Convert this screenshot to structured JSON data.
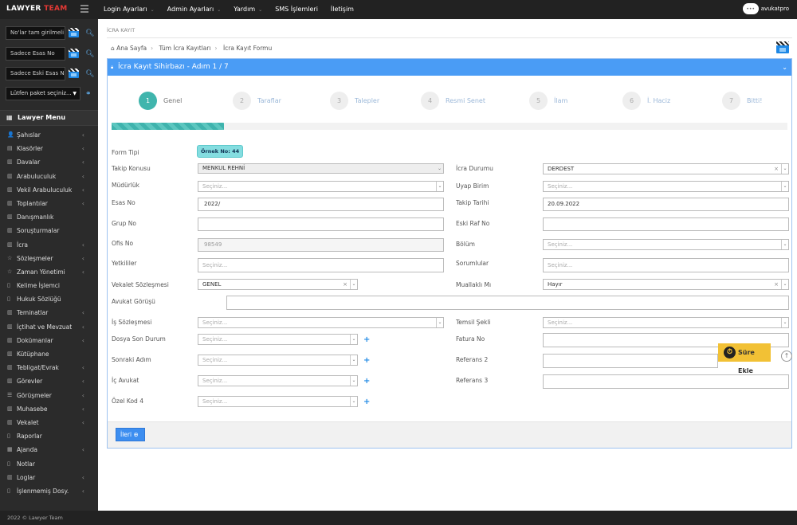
{
  "brand": {
    "name": "LAWYER",
    "accent": "TEAM",
    "accent_color": "#e53935"
  },
  "topnav": [
    {
      "label": "Login Ayarları",
      "caret": true
    },
    {
      "label": "Admin Ayarları",
      "caret": true
    },
    {
      "label": "Yardım",
      "caret": true
    },
    {
      "label": "SMS İşlemleri",
      "caret": false
    },
    {
      "label": "İletişim",
      "caret": false
    }
  ],
  "user": {
    "name": "avukatpro",
    "avatar": "•••"
  },
  "search": [
    {
      "placeholder": "No'lar tam girilmeli"
    },
    {
      "placeholder": "Sadece Esas No"
    },
    {
      "placeholder": "Sadece Eski Esas No"
    }
  ],
  "package_select": "Lütfen paket seçiniz...",
  "menu_title": "Lawyer Menu",
  "menu": [
    {
      "label": "Şahıslar",
      "icon": "user-icon",
      "glyph": "👤",
      "chevron": true
    },
    {
      "label": "Klasörler",
      "icon": "folder-icon",
      "glyph": "▤",
      "chevron": true
    },
    {
      "label": "Davalar",
      "icon": "bank-icon",
      "glyph": "▥",
      "chevron": true
    },
    {
      "label": "Arabuluculuk",
      "icon": "bank-icon",
      "glyph": "▥",
      "chevron": true
    },
    {
      "label": "Vekil Arabuluculuk",
      "icon": "bank-icon",
      "glyph": "▥",
      "chevron": true
    },
    {
      "label": "Toplantılar",
      "icon": "bank-icon",
      "glyph": "▥",
      "chevron": true
    },
    {
      "label": "Danışmanlık",
      "icon": "bank-icon",
      "glyph": "▥",
      "chevron": false
    },
    {
      "label": "Soruşturmalar",
      "icon": "bank-icon",
      "glyph": "▥",
      "chevron": false
    },
    {
      "label": "İcra",
      "icon": "bank-icon",
      "glyph": "▥",
      "chevron": true
    },
    {
      "label": "Sözleşmeler",
      "icon": "star-icon",
      "glyph": "☆",
      "chevron": true
    },
    {
      "label": "Zaman Yönetimi",
      "icon": "star-icon",
      "glyph": "☆",
      "chevron": true
    },
    {
      "label": "Kelime İşlemci",
      "icon": "document-icon",
      "glyph": "▯",
      "chevron": false
    },
    {
      "label": "Hukuk Sözlüğü",
      "icon": "document-icon",
      "glyph": "▯",
      "chevron": false
    },
    {
      "label": "Teminatlar",
      "icon": "bank-icon",
      "glyph": "▥",
      "chevron": true
    },
    {
      "label": "İçtihat ve Mevzuat",
      "icon": "bank-icon",
      "glyph": "▥",
      "chevron": true
    },
    {
      "label": "Dokümanlar",
      "icon": "bank-icon",
      "glyph": "▥",
      "chevron": true
    },
    {
      "label": "Kütüphane",
      "icon": "bank-icon",
      "glyph": "▥",
      "chevron": false
    },
    {
      "label": "Tebligat/Evrak",
      "icon": "bank-icon",
      "glyph": "▥",
      "chevron": true
    },
    {
      "label": "Görevler",
      "icon": "bank-icon",
      "glyph": "▥",
      "chevron": true
    },
    {
      "label": "Görüşmeler",
      "icon": "chat-icon",
      "glyph": "☰",
      "chevron": true
    },
    {
      "label": "Muhasebe",
      "icon": "bank-icon",
      "glyph": "▥",
      "chevron": true
    },
    {
      "label": "Vekalet",
      "icon": "bank-icon",
      "glyph": "▥",
      "chevron": true
    },
    {
      "label": "Raporlar",
      "icon": "document-icon",
      "glyph": "▯",
      "chevron": false
    },
    {
      "label": "Ajanda",
      "icon": "calendar-icon",
      "glyph": "▦",
      "chevron": true
    },
    {
      "label": "Notlar",
      "icon": "document-icon",
      "glyph": "▯",
      "chevron": false
    },
    {
      "label": "Loglar",
      "icon": "bank-icon",
      "glyph": "▥",
      "chevron": true
    },
    {
      "label": "İşlenmemiş Dosy.",
      "icon": "document-icon",
      "glyph": "▯",
      "chevron": true
    }
  ],
  "footer": "2022 © Lawyer Team",
  "page_crumb": "İCRA KAYIT",
  "breadcrumb": [
    "Ana Sayfa",
    "Tüm İcra Kayıtları",
    "İcra Kayıt Formu"
  ],
  "panel_title": "İcra Kayıt Sihirbazı - Adım 1 / 7",
  "steps": [
    {
      "num": "1",
      "label": "Genel",
      "active": true
    },
    {
      "num": "2",
      "label": "Taraflar",
      "active": false
    },
    {
      "num": "3",
      "label": "Talepler",
      "active": false
    },
    {
      "num": "4",
      "label": "Resmi Senet",
      "active": false
    },
    {
      "num": "5",
      "label": "İlam",
      "active": false
    },
    {
      "num": "6",
      "label": "İ. Haciz",
      "active": false
    },
    {
      "num": "7",
      "label": "Bitti!",
      "active": false
    }
  ],
  "progress_fraction": 0.1667,
  "form": {
    "form_tipi": {
      "label": "Form Tipi",
      "badge": "Örnek No: 44"
    },
    "takip_konusu": {
      "label": "Takip Konusu",
      "value": "MENKUL REHNİ"
    },
    "icra_durumu": {
      "label": "İcra Durumu",
      "value": "DERDEST"
    },
    "mudurluk": {
      "label": "Müdürlük",
      "placeholder": "Seçiniz..."
    },
    "uyap_birim": {
      "label": "Uyap Birim",
      "placeholder": "Seçiniz..."
    },
    "esas_no": {
      "label": "Esas No",
      "value": "2022/"
    },
    "takip_tarihi": {
      "label": "Takip Tarihi",
      "value": "20.09.2022"
    },
    "grup_no": {
      "label": "Grup No",
      "value": ""
    },
    "eski_raf_no": {
      "label": "Eski Raf No",
      "value": ""
    },
    "ofis_no": {
      "label": "Ofis No",
      "value": "98549"
    },
    "bolum": {
      "label": "Bölüm",
      "placeholder": "Seçiniz..."
    },
    "yetkililer": {
      "label": "Yetkililer",
      "placeholder": "Seçiniz..."
    },
    "sorumlular": {
      "label": "Sorumlular",
      "placeholder": "Seçiniz..."
    },
    "vekalet": {
      "label": "Vekalet Sözleşmesi",
      "value": "GENEL"
    },
    "muallakli": {
      "label": "Muallaklı Mı",
      "value": "Hayır"
    },
    "avukat_gorusu": {
      "label": "Avukat Görüşü",
      "value": ""
    },
    "is_sozlesmesi": {
      "label": "İş Sözleşmesi",
      "placeholder": "Seçiniz..."
    },
    "temsil_sekli": {
      "label": "Temsil Şekli",
      "placeholder": "Seçiniz..."
    },
    "dosya_son_durum": {
      "label": "Dosya Son Durum",
      "placeholder": "Seçiniz..."
    },
    "fatura_no": {
      "label": "Fatura No",
      "value": ""
    },
    "sonraki_adim": {
      "label": "Sonraki Adım",
      "placeholder": "Seçiniz..."
    },
    "referans2": {
      "label": "Referans 2",
      "value": ""
    },
    "ic_avukat": {
      "label": "İç Avukat",
      "placeholder": "Seçiniz..."
    },
    "referans3": {
      "label": "Referans 3",
      "value": ""
    },
    "ozel_kod4": {
      "label": "Özel Kod 4",
      "placeholder": "Seçiniz..."
    }
  },
  "sure_ekle": "Süre Ekle",
  "next_button": "İleri",
  "colors": {
    "primary": "#4a9cf5",
    "teal": "#40b5ad",
    "warning": "#f2c135"
  }
}
